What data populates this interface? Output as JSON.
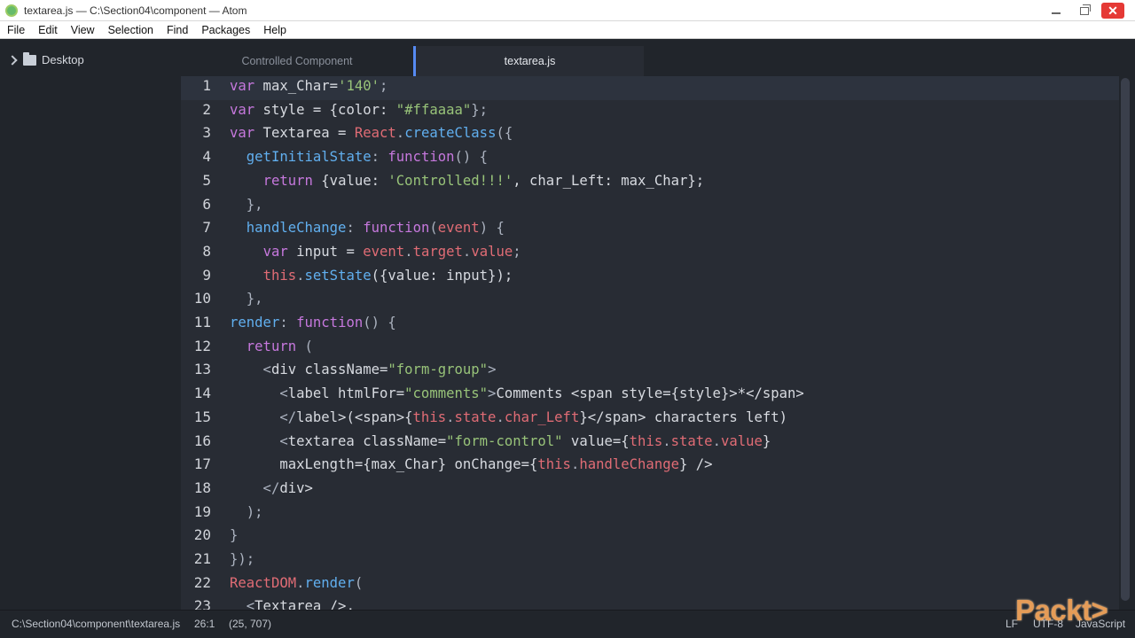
{
  "window": {
    "title": "textarea.js — C:\\Section04\\component — Atom",
    "controls": {
      "minimize": "—",
      "maximize": "❐",
      "close": "✕"
    }
  },
  "menu": [
    "File",
    "Edit",
    "View",
    "Selection",
    "Find",
    "Packages",
    "Help"
  ],
  "tree": {
    "root_label": "Desktop"
  },
  "tabs": [
    {
      "label": "Controlled Component",
      "active": false
    },
    {
      "label": "textarea.js",
      "active": true
    }
  ],
  "editor": {
    "line_numbers": [
      "1",
      "2",
      "3",
      "4",
      "5",
      "6",
      "7",
      "8",
      "9",
      "10",
      "11",
      "12",
      "13",
      "14",
      "15",
      "16",
      "17",
      "18",
      "19",
      "20",
      "21",
      "22",
      "23"
    ],
    "lines": [
      [
        [
          "k",
          "var"
        ],
        [
          "d",
          " max_Char="
        ],
        [
          "s",
          "'140'"
        ],
        [
          "p",
          ";"
        ]
      ],
      [
        [
          "k",
          "var"
        ],
        [
          "d",
          " style = {color: "
        ],
        [
          "s",
          "\"#ffaaaa\""
        ],
        [
          "p",
          "};"
        ]
      ],
      [
        [
          "k",
          "var"
        ],
        [
          "d",
          " Textarea = "
        ],
        [
          "v",
          "React"
        ],
        [
          "p",
          "."
        ],
        [
          "f",
          "createClass"
        ],
        [
          "p",
          "({"
        ]
      ],
      [
        [
          "p",
          "  "
        ],
        [
          "f",
          "getInitialState"
        ],
        [
          "p",
          ": "
        ],
        [
          "k",
          "function"
        ],
        [
          "p",
          "() {"
        ]
      ],
      [
        [
          "p",
          "    "
        ],
        [
          "k",
          "return"
        ],
        [
          "d",
          " {value: "
        ],
        [
          "s",
          "'Controlled!!!'"
        ],
        [
          "d",
          ", char_Left: max_Char};"
        ]
      ],
      [
        [
          "p",
          "  },"
        ]
      ],
      [
        [
          "p",
          "  "
        ],
        [
          "f",
          "handleChange"
        ],
        [
          "p",
          ": "
        ],
        [
          "k",
          "function"
        ],
        [
          "p",
          "("
        ],
        [
          "v",
          "event"
        ],
        [
          "p",
          ") {"
        ]
      ],
      [
        [
          "p",
          "    "
        ],
        [
          "k",
          "var"
        ],
        [
          "d",
          " input = "
        ],
        [
          "v",
          "event"
        ],
        [
          "p",
          "."
        ],
        [
          "v",
          "target"
        ],
        [
          "p",
          "."
        ],
        [
          "v",
          "value"
        ],
        [
          "p",
          ";"
        ]
      ],
      [
        [
          "p",
          "    "
        ],
        [
          "v",
          "this"
        ],
        [
          "p",
          "."
        ],
        [
          "f",
          "setState"
        ],
        [
          "d",
          "({value: input});"
        ]
      ],
      [
        [
          "p",
          "  },"
        ]
      ],
      [
        [
          "f",
          "render"
        ],
        [
          "p",
          ": "
        ],
        [
          "k",
          "function"
        ],
        [
          "p",
          "() {"
        ]
      ],
      [
        [
          "p",
          "  "
        ],
        [
          "k",
          "return"
        ],
        [
          "p",
          " ("
        ]
      ],
      [
        [
          "p",
          "    <"
        ],
        [
          "d",
          "div className="
        ],
        [
          "s",
          "\"form-group\""
        ],
        [
          "p",
          ">"
        ]
      ],
      [
        [
          "p",
          "      <"
        ],
        [
          "d",
          "label htmlFor="
        ],
        [
          "s",
          "\"comments\""
        ],
        [
          "p",
          ">"
        ],
        [
          "d",
          "Comments <span style={style}>*</span>"
        ]
      ],
      [
        [
          "p",
          "      </"
        ],
        [
          "d",
          "label>(<span>{"
        ],
        [
          "v",
          "this"
        ],
        [
          "p",
          "."
        ],
        [
          "v",
          "state"
        ],
        [
          "p",
          "."
        ],
        [
          "v",
          "char_Left"
        ],
        [
          "d",
          "}</span> characters left)"
        ]
      ],
      [
        [
          "p",
          "      <"
        ],
        [
          "d",
          "textarea className="
        ],
        [
          "s",
          "\"form-control\""
        ],
        [
          "d",
          " value={"
        ],
        [
          "v",
          "this"
        ],
        [
          "p",
          "."
        ],
        [
          "v",
          "state"
        ],
        [
          "p",
          "."
        ],
        [
          "v",
          "value"
        ],
        [
          "d",
          "}"
        ]
      ],
      [
        [
          "d",
          "      maxLength={max_Char} onChange={"
        ],
        [
          "v",
          "this"
        ],
        [
          "p",
          "."
        ],
        [
          "v",
          "handleChange"
        ],
        [
          "d",
          "} />"
        ]
      ],
      [
        [
          "p",
          "    </"
        ],
        [
          "d",
          "div>"
        ]
      ],
      [
        [
          "p",
          "  );"
        ]
      ],
      [
        [
          "p",
          "}"
        ]
      ],
      [
        [
          "p",
          "});"
        ]
      ],
      [
        [
          "v",
          "ReactDOM"
        ],
        [
          "p",
          "."
        ],
        [
          "f",
          "render"
        ],
        [
          "p",
          "("
        ]
      ],
      [
        [
          "p",
          "  <"
        ],
        [
          "d",
          "Textarea />,"
        ]
      ]
    ]
  },
  "status": {
    "path": "C:\\Section04\\component\\textarea.js",
    "cursor": "26:1",
    "coords": "(25, 707)",
    "line_ending": "LF",
    "encoding": "UTF-8",
    "grammar": "JavaScript"
  },
  "watermark": "Packt>",
  "colors": {
    "keyword": "#c678dd",
    "string": "#98c379",
    "variable": "#e06c75",
    "function": "#61afef",
    "text": "#abb2bf",
    "editor_bg": "#282c34",
    "chrome_bg": "#21252b",
    "accent": "#568af2"
  }
}
